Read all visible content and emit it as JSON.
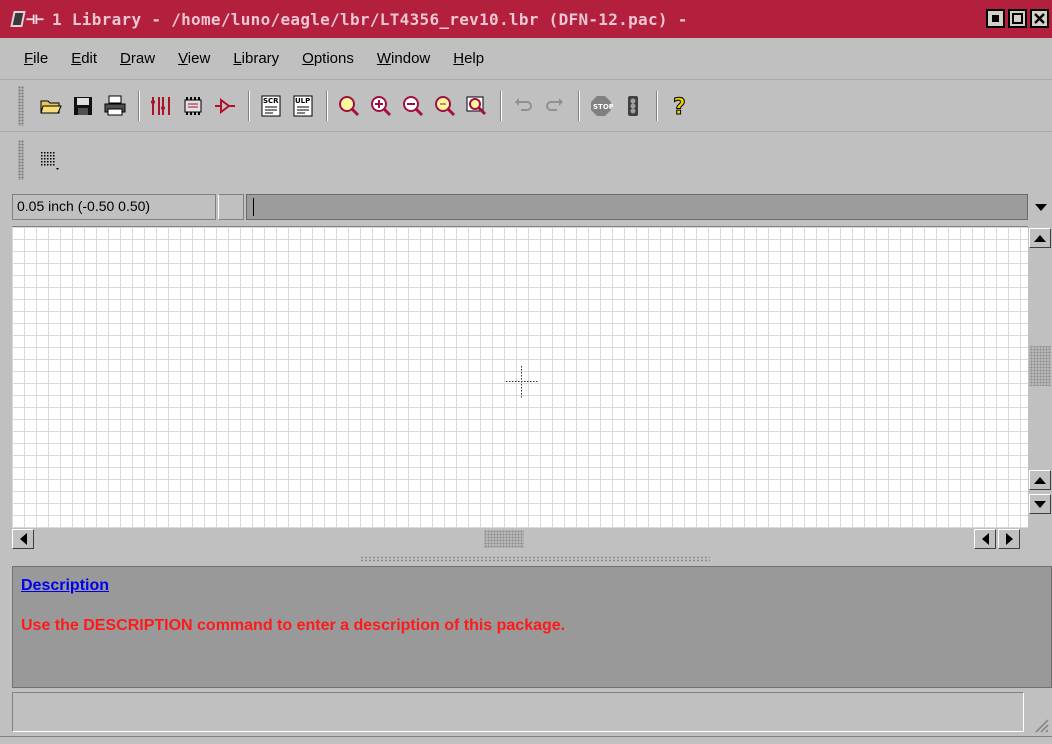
{
  "window": {
    "title": "1 Library - /home/luno/eagle/lbr/LT4356_rev10.lbr (DFN-12.pac) -",
    "title_color": "#b3203e",
    "buttons": [
      "minimize",
      "maximize",
      "close"
    ]
  },
  "menubar": {
    "items": [
      {
        "label": "File"
      },
      {
        "label": "Edit"
      },
      {
        "label": "Draw"
      },
      {
        "label": "View"
      },
      {
        "label": "Library"
      },
      {
        "label": "Options"
      },
      {
        "label": "Window"
      },
      {
        "label": "Help"
      }
    ]
  },
  "toolbar": {
    "buttons": [
      "open-icon",
      "save-icon",
      "print-icon",
      "separator",
      "schematic-icon",
      "package-icon",
      "symbol-icon",
      "separator",
      "script-icon",
      "ulp-icon",
      "separator",
      "zoom-fit-icon",
      "zoom-in-icon",
      "zoom-out-icon",
      "zoom-redraw-icon",
      "zoom-select-icon",
      "separator",
      "undo-icon",
      "redo-icon",
      "separator",
      "stop-icon",
      "go-icon",
      "separator",
      "help-icon"
    ]
  },
  "toolbar2": {
    "buttons": [
      "grid-icon"
    ]
  },
  "command": {
    "coordinates": "0.05 inch (-0.50 0.50)",
    "input_value": ""
  },
  "description": {
    "title": "Description",
    "text": "Use the DESCRIPTION command to enter a description of this package.",
    "title_color": "#0000ee",
    "text_color": "#ff1a1a"
  },
  "statusbar": {
    "text": ""
  }
}
